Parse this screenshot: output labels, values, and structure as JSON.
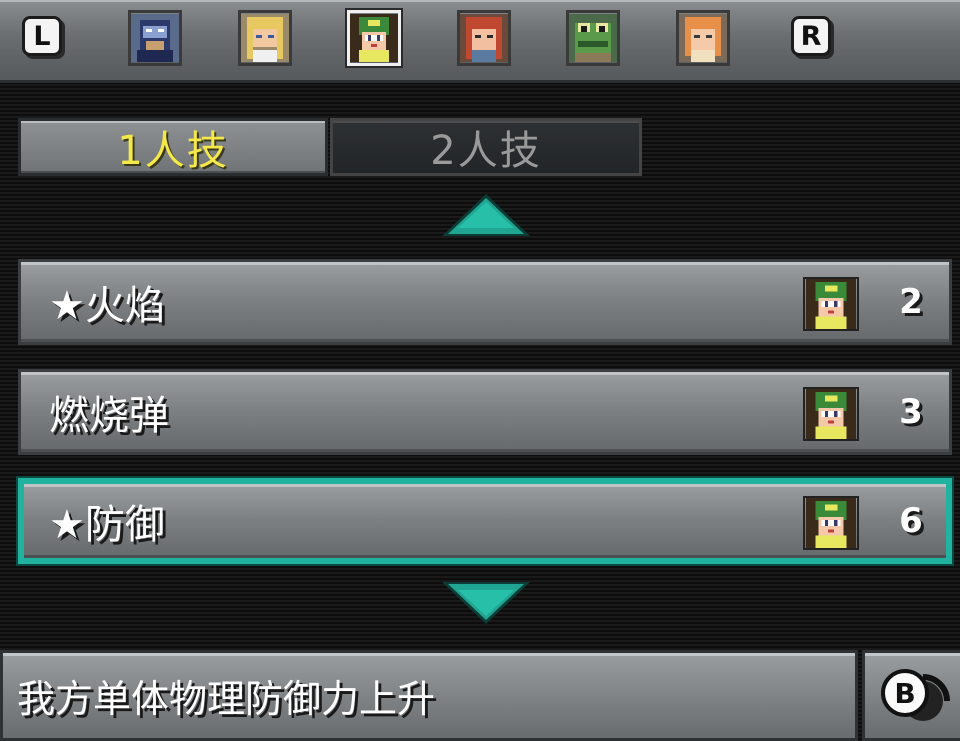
{
  "shoulder_buttons": {
    "left": "L",
    "right": "R"
  },
  "party": [
    {
      "icon": "masked-knight-portrait-icon",
      "selected": false
    },
    {
      "icon": "blonde-girl-portrait-icon",
      "selected": false
    },
    {
      "icon": "green-helmet-girl-portrait-icon",
      "selected": true
    },
    {
      "icon": "red-haired-girl-portrait-icon",
      "selected": false
    },
    {
      "icon": "frog-knight-portrait-icon",
      "selected": false
    },
    {
      "icon": "orange-haired-girl-portrait-icon",
      "selected": false
    }
  ],
  "tabs": [
    {
      "label": "1人技",
      "active": true
    },
    {
      "label": "2人技",
      "active": false
    }
  ],
  "skills": [
    {
      "name": "★火焰",
      "cost": "2",
      "icon": "green-helmet-girl-portrait-icon",
      "selected": false
    },
    {
      "name": "燃烧弹",
      "cost": "3",
      "icon": "green-helmet-girl-portrait-icon",
      "selected": false
    },
    {
      "name": "★防御",
      "cost": "6",
      "icon": "green-helmet-girl-portrait-icon",
      "selected": true
    }
  ],
  "description": "我方单体物理防御力上升",
  "back_button": {
    "key": "B",
    "icon": "b-back-icon"
  },
  "colors": {
    "highlight": "#22b3a0",
    "active_tab_text": "#f4e84a",
    "inactive_tab_text": "#9a9a9a"
  }
}
